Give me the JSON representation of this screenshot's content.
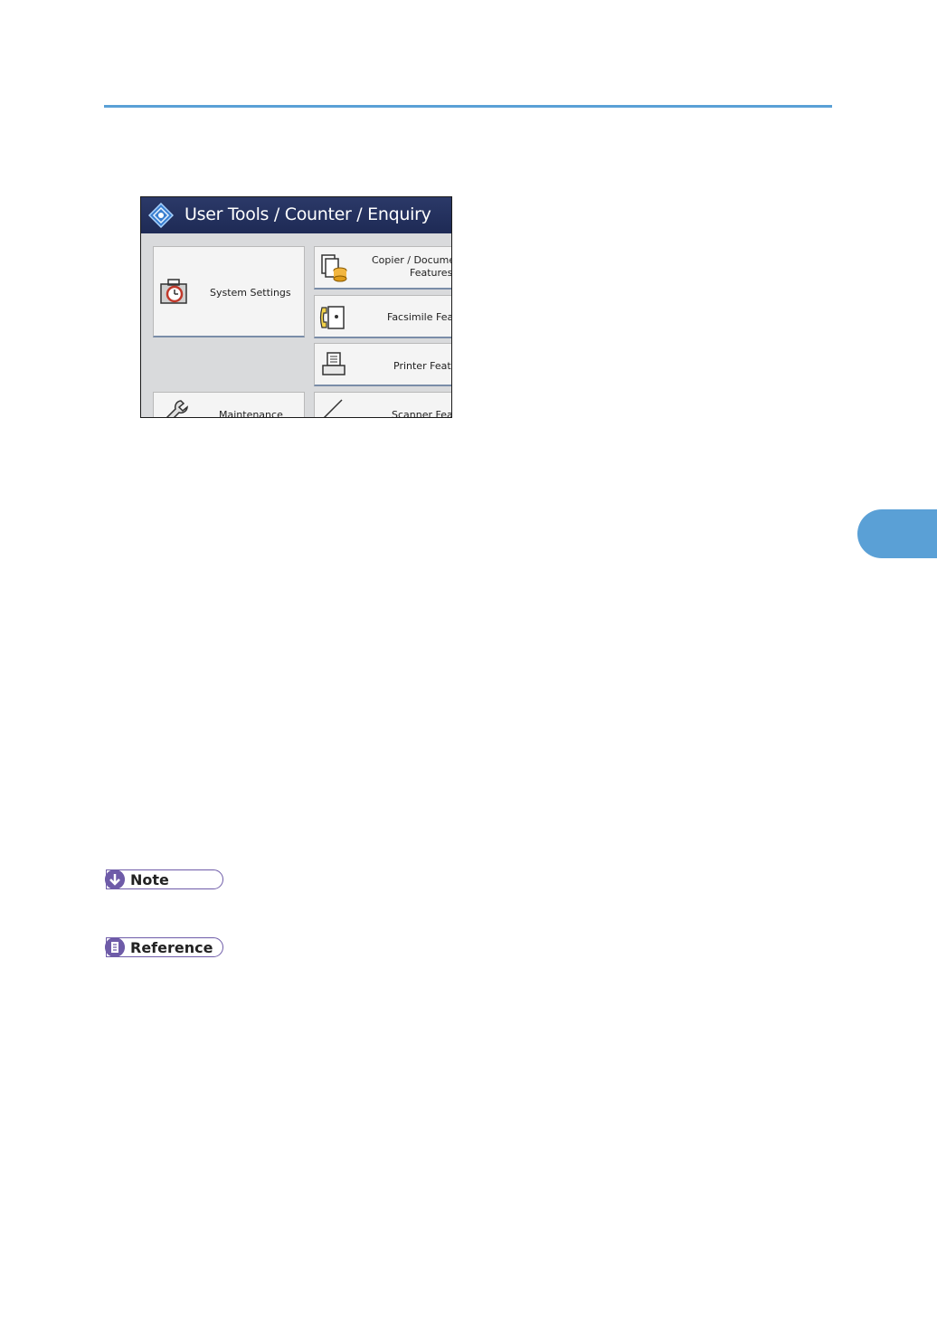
{
  "colors": {
    "accent": "#5aa0d6",
    "badge": "#6e5ba8",
    "title_bar": "#1e2a55"
  },
  "panel": {
    "title": "User Tools / Counter / Enquiry",
    "buttons": [
      {
        "id": "system",
        "label": "System Settings",
        "icon": "toolbox-clock-icon"
      },
      {
        "id": "copier",
        "label_line1": "Copier / Document",
        "label_line2": "Features",
        "icon": "copier-icon"
      },
      {
        "id": "fax",
        "label": "Facsimile Features",
        "icon": "fax-icon"
      },
      {
        "id": "printer",
        "label": "Printer Features",
        "icon": "printer-icon"
      },
      {
        "id": "maintenance",
        "label": "Maintenance",
        "icon": "wrench-icon"
      },
      {
        "id": "scanner",
        "label": "Scanner Features",
        "icon": "scanner-icon"
      }
    ]
  },
  "note": {
    "label": "Note",
    "icon": "down-arrow-icon"
  },
  "reference": {
    "label": "Reference",
    "icon": "document-icon"
  }
}
